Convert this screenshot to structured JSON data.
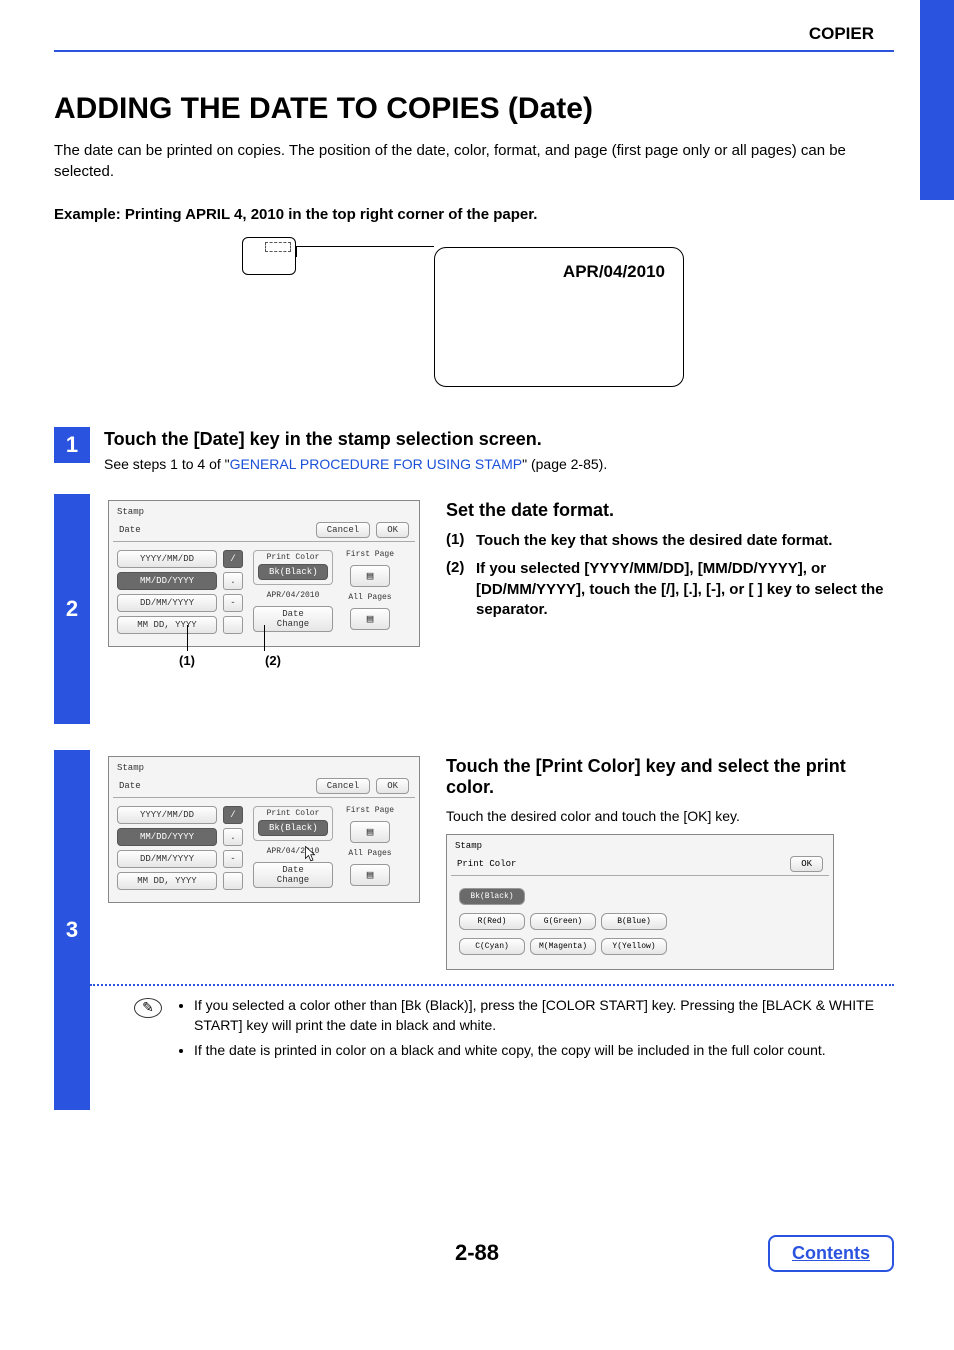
{
  "header": {
    "breadcrumb": "COPIER"
  },
  "title": "ADDING THE DATE TO COPIES (Date)",
  "intro": "The date can be printed on copies. The position of the date, color, format, and page (first page only or all pages) can be selected.",
  "example_line": "Example: Printing APRIL 4, 2010 in the top right corner of the paper.",
  "paper_date": "APR/04/2010",
  "step1": {
    "num": "1",
    "title": "Touch the [Date] key in the stamp selection screen.",
    "sub_pre": "See steps 1 to 4 of \"",
    "sub_link": "GENERAL PROCEDURE FOR USING STAMP",
    "sub_post": "\" (page 2-85)."
  },
  "ui_panel": {
    "stamp": "Stamp",
    "date": "Date",
    "cancel": "Cancel",
    "ok": "OK",
    "fmt1": "YYYY/MM/DD",
    "fmt2": "MM/DD/YYYY",
    "fmt3": "DD/MM/YYYY",
    "fmt4": "MM DD, YYYY",
    "sep1": "/",
    "sep2": ".",
    "sep3": "-",
    "sep4": " ",
    "print_color": "Print Color",
    "bk": "Bk(Black)",
    "preview": "APR/04/2010",
    "date_change": "Date Change",
    "first_page": "First Page",
    "all_pages": "All Pages",
    "callout1": "(1)",
    "callout2": "(2)"
  },
  "step2": {
    "num": "2",
    "title": "Set the date format.",
    "i1_num": "(1)",
    "i1": "Touch the key that shows the desired date format.",
    "i2_num": "(2)",
    "i2": "If you selected [YYYY/MM/DD], [MM/DD/YYYY], or [DD/MM/YYYY], touch the [/], [.], [-], or [ ] key to select the separator."
  },
  "step3": {
    "num": "3",
    "title": "Touch the [Print Color] key and select the print color.",
    "sub": "Touch the desired color and touch the [OK] key."
  },
  "color_panel": {
    "stamp": "Stamp",
    "title": "Print Color",
    "ok": "OK",
    "c1": "Bk(Black)",
    "c2": "R(Red)",
    "c3": "G(Green)",
    "c4": "B(Blue)",
    "c5": "C(Cyan)",
    "c6": "M(Magenta)",
    "c7": "Y(Yellow)"
  },
  "notes": {
    "n1": "If you selected a color other than [Bk (Black)], press the [COLOR START] key. Pressing the [BLACK & WHITE START] key will print the date in black and white.",
    "n2": "If the date is printed in color on a black and white copy, the copy will be included in the full color count."
  },
  "page_number": "2-88",
  "contents_btn": "Contents"
}
